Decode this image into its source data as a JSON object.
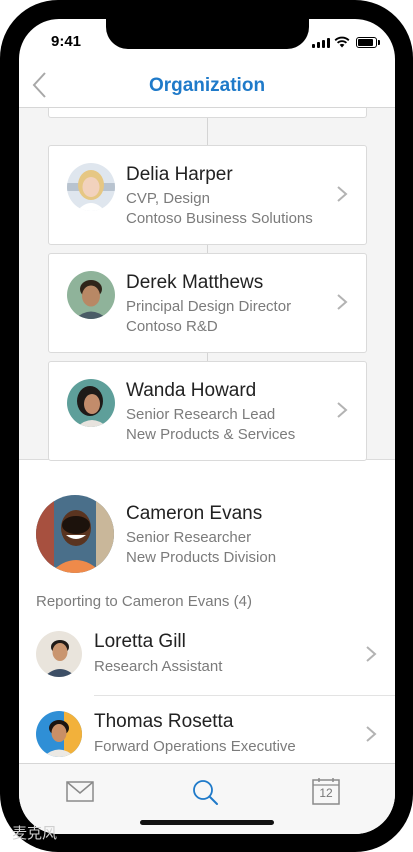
{
  "status": {
    "time": "9:41"
  },
  "nav": {
    "title": "Organization",
    "back_icon": "chevron-left-icon"
  },
  "chain": [
    {
      "name": "Delia Harper",
      "line1": "CVP, Design",
      "line2": "Contoso Business Solutions"
    },
    {
      "name": "Derek Matthews",
      "line1": "Principal Design Director",
      "line2": "Contoso R&D"
    },
    {
      "name": "Wanda Howard",
      "line1": "Senior Research Lead",
      "line2": "New Products & Services"
    }
  ],
  "focus": {
    "name": "Cameron Evans",
    "line1": "Senior Researcher",
    "line2": "New Products Division"
  },
  "reports_label": "Reporting to Cameron Evans (4)",
  "reports": [
    {
      "name": "Loretta Gill",
      "title": "Research Assistant"
    },
    {
      "name": "Thomas Rosetta",
      "title": "Forward Operations Executive"
    }
  ],
  "tabs": [
    {
      "icon": "mail-icon",
      "label": ""
    },
    {
      "icon": "search-icon",
      "label": ""
    },
    {
      "icon": "calendar-icon",
      "label": "12"
    }
  ],
  "colors": {
    "accent": "#1f7ac9",
    "text": "#222222",
    "secondary": "#7b7b7b"
  },
  "watermark": "麦克风"
}
